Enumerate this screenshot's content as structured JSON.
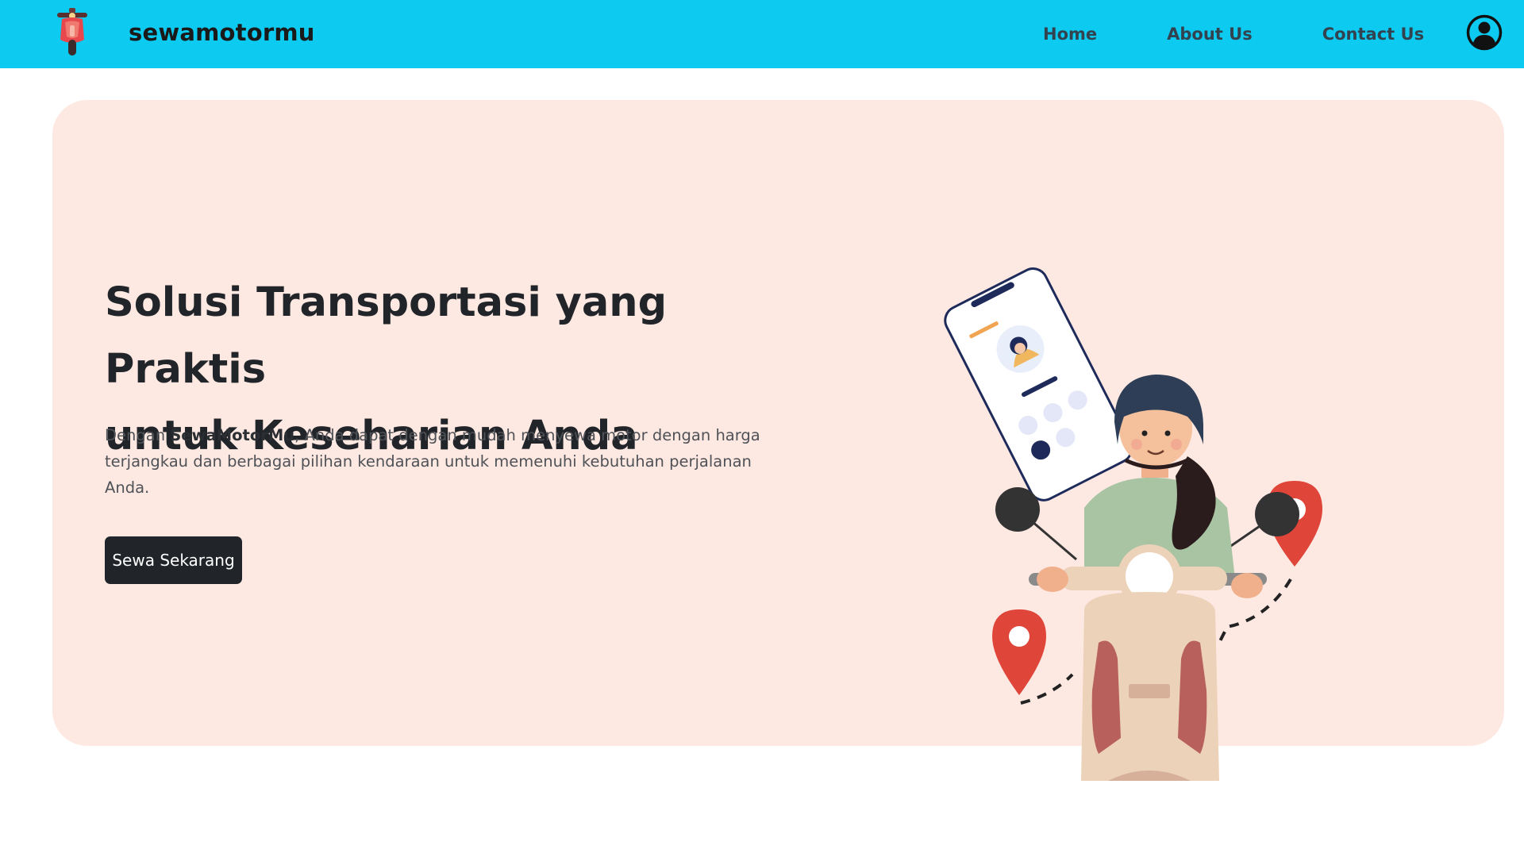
{
  "navbar": {
    "brand_name": "sewamotormu",
    "links": [
      {
        "label": "Home"
      },
      {
        "label": "About Us"
      },
      {
        "label": "Contact Us"
      }
    ],
    "user_icon": "user-circle-icon"
  },
  "hero": {
    "title_line1": "Solusi Transportasi yang Praktis",
    "title_line2": "untuk Keseharian Anda",
    "desc_prefix": "Dengan ",
    "desc_brand": "SewaMotorMu",
    "desc_suffix": ", Anda dapat dengan mudah menyewa motor dengan harga terjangkau dan berbagai pilihan kendaraan untuk memenuhi kebutuhan perjalanan Anda.",
    "cta_label": "Sewa Sekarang",
    "illustration": "woman-riding-scooter-with-phone-and-map-pins"
  },
  "colors": {
    "navbar_bg": "#0dcaf0",
    "hero_bg": "#fde8e2",
    "button_bg": "#212529",
    "pin_red": "#e0453a"
  }
}
